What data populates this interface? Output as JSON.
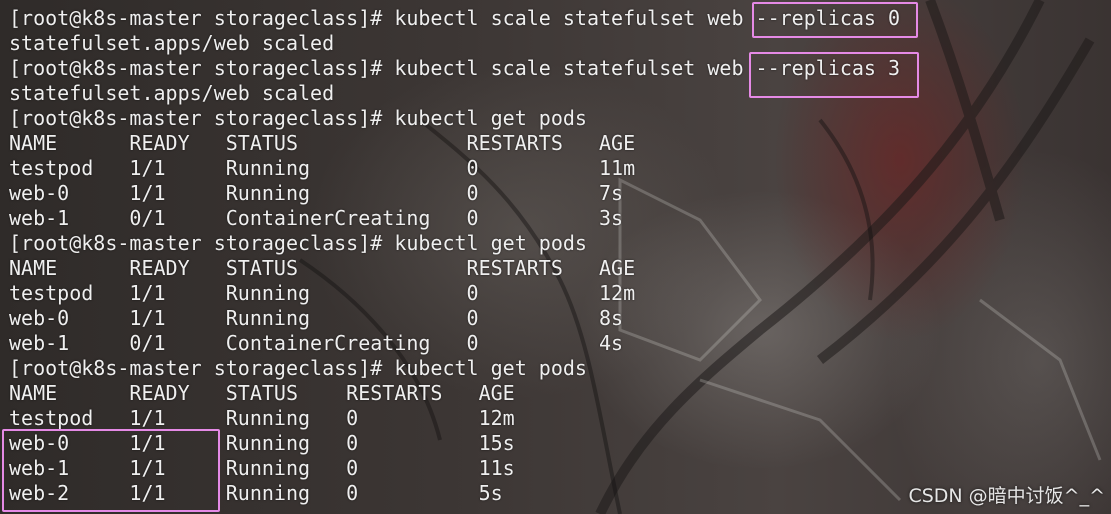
{
  "terminal": {
    "lines": [
      "[root@k8s-master storageclass]# kubectl scale statefulset web --replicas 0",
      "statefulset.apps/web scaled",
      "[root@k8s-master storageclass]# kubectl scale statefulset web --replicas 3",
      "statefulset.apps/web scaled",
      "[root@k8s-master storageclass]# kubectl get pods",
      "NAME      READY   STATUS              RESTARTS   AGE",
      "testpod   1/1     Running             0          11m",
      "web-0     1/1     Running             0          7s",
      "web-1     0/1     ContainerCreating   0          3s",
      "[root@k8s-master storageclass]# kubectl get pods",
      "NAME      READY   STATUS              RESTARTS   AGE",
      "testpod   1/1     Running             0          12m",
      "web-0     1/1     Running             0          8s",
      "web-1     0/1     ContainerCreating   0          4s",
      "[root@k8s-master storageclass]# kubectl get pods",
      "NAME      READY   STATUS    RESTARTS   AGE",
      "testpod   1/1     Running   0          12m",
      "web-0     1/1     Running   0          15s",
      "web-1     1/1     Running   0          11s",
      "web-2     1/1     Running   0          5s"
    ]
  },
  "watermark": "CSDN @暗中讨饭^_^",
  "colors": {
    "text": "#efefef",
    "highlight": "#e58ae6"
  }
}
